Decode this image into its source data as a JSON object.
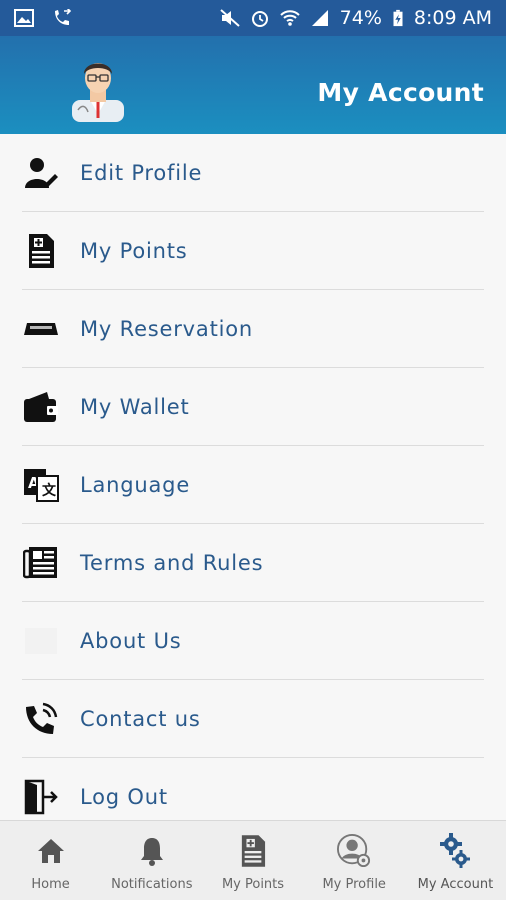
{
  "status_bar": {
    "battery": "74%",
    "time": "8:09 AM"
  },
  "header": {
    "title": "My Account"
  },
  "menu": {
    "items": [
      {
        "label": "Edit Profile",
        "icon": "edit-profile-icon"
      },
      {
        "label": "My Points",
        "icon": "points-document-icon"
      },
      {
        "label": "My Reservation",
        "icon": "reservation-icon"
      },
      {
        "label": "My Wallet",
        "icon": "wallet-icon"
      },
      {
        "label": "Language",
        "icon": "language-icon"
      },
      {
        "label": "Terms and Rules",
        "icon": "newspaper-icon"
      },
      {
        "label": "About Us",
        "icon": "about-icon"
      },
      {
        "label": "Contact us",
        "icon": "phone-icon"
      },
      {
        "label": "Log Out",
        "icon": "logout-icon"
      }
    ]
  },
  "bottom_nav": {
    "items": [
      {
        "label": "Home",
        "icon": "home-icon"
      },
      {
        "label": "Notifications",
        "icon": "bell-icon"
      },
      {
        "label": "My Points",
        "icon": "points-document-icon"
      },
      {
        "label": "My Profile",
        "icon": "profile-settings-icon"
      },
      {
        "label": "My Account",
        "icon": "gears-icon",
        "active": true
      }
    ]
  },
  "colors": {
    "header": "#1b8fc0",
    "status_bar": "#245a9a",
    "menu_text": "#2a5a8c",
    "active_nav_icon": "#2a5a8c"
  }
}
